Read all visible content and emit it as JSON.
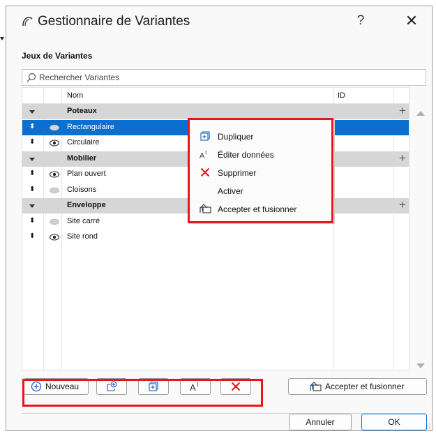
{
  "window": {
    "title": "Gestionnaire de Variantes",
    "help_label": "?",
    "close_label": "✕"
  },
  "section_title": "Jeux de Variantes",
  "search": {
    "placeholder": "Rechercher Variantes"
  },
  "table": {
    "headers": {
      "name": "Nom",
      "id": "ID"
    },
    "rows": [
      {
        "label": "Poteaux",
        "type": "group",
        "plus": "+"
      },
      {
        "label": "Rectangulaire",
        "type": "item",
        "eye": "hidden",
        "selected": true
      },
      {
        "label": "Circulaire",
        "type": "item",
        "eye": "visible"
      },
      {
        "label": "Mobilier",
        "type": "group",
        "plus": "+"
      },
      {
        "label": "Plan ouvert",
        "type": "item",
        "eye": "visible"
      },
      {
        "label": "Cloisons",
        "type": "item",
        "eye": "hidden"
      },
      {
        "label": "Enveloppe",
        "type": "group",
        "plus": "+"
      },
      {
        "label": "Site carré",
        "type": "item",
        "eye": "hidden"
      },
      {
        "label": "Site rond",
        "type": "item",
        "eye": "visible"
      }
    ]
  },
  "context_menu": {
    "items": [
      {
        "label": "Dupliquer",
        "icon": "duplicate-icon"
      },
      {
        "label": "Éditer données",
        "icon": "edit-data-icon"
      },
      {
        "label": "Supprimer",
        "icon": "delete-icon"
      },
      {
        "label": "Activer",
        "icon": ""
      },
      {
        "label": "Accepter et fusionner",
        "icon": "accept-merge-icon"
      }
    ]
  },
  "toolbar": {
    "new_label": "Nouveau",
    "accept_merge_label": "Accepter et fusionner"
  },
  "footer": {
    "cancel_label": "Annuler",
    "ok_label": "OK"
  },
  "colors": {
    "selection": "#0a6fd0",
    "highlight": "#e8141e",
    "group_row": "#d6d6d6",
    "delete": "#e8141e"
  }
}
